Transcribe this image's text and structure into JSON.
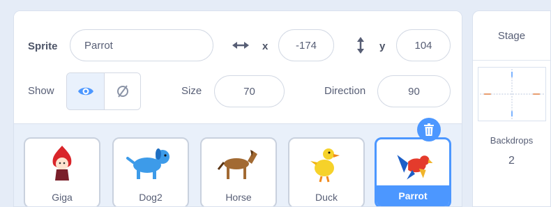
{
  "sprite_info": {
    "sprite_label": "Sprite",
    "sprite_name": "Parrot",
    "x_label": "x",
    "x_value": "-174",
    "y_label": "y",
    "y_value": "104",
    "show_label": "Show",
    "size_label": "Size",
    "size_value": "70",
    "direction_label": "Direction",
    "direction_value": "90",
    "visible": true
  },
  "sprites": [
    {
      "name": "Giga",
      "icon": "giga-sprite-icon",
      "selected": false
    },
    {
      "name": "Dog2",
      "icon": "dog-sprite-icon",
      "selected": false
    },
    {
      "name": "Horse",
      "icon": "horse-sprite-icon",
      "selected": false
    },
    {
      "name": "Duck",
      "icon": "duck-sprite-icon",
      "selected": false
    },
    {
      "name": "Parrot",
      "icon": "parrot-sprite-icon",
      "selected": true
    }
  ],
  "stage": {
    "title": "Stage",
    "backdrops_label": "Backdrops",
    "backdrops_count": "2"
  },
  "colors": {
    "accent": "#4c97ff",
    "text": "#575e75",
    "pane_background": "#e9f0fa"
  }
}
